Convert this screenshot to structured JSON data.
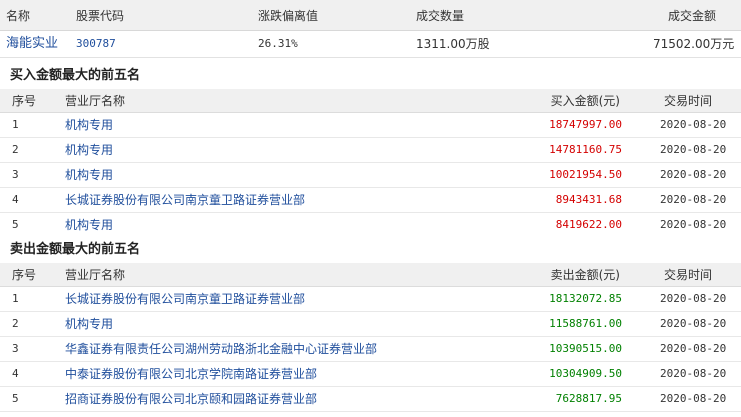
{
  "summary": {
    "headers": [
      "名称",
      "股票代码",
      "涨跌偏离值",
      "成交数量",
      "成交金额"
    ],
    "name": "海能实业",
    "code": "300787",
    "deviation": "26.31%",
    "volume": "1311.00万股",
    "amount": "71502.00万元"
  },
  "buy": {
    "title": "买入金额最大的前五名",
    "col_no": "序号",
    "col_dept": "营业厅名称",
    "col_amount": "买入金额(元)",
    "col_date": "交易时间",
    "rows": [
      {
        "no": "1",
        "dept": "机构专用",
        "amount": "18747997.00",
        "date": "2020-08-20"
      },
      {
        "no": "2",
        "dept": "机构专用",
        "amount": "14781160.75",
        "date": "2020-08-20"
      },
      {
        "no": "3",
        "dept": "机构专用",
        "amount": "10021954.50",
        "date": "2020-08-20"
      },
      {
        "no": "4",
        "dept": "长城证券股份有限公司南京童卫路证券营业部",
        "amount": "8943431.68",
        "date": "2020-08-20"
      },
      {
        "no": "5",
        "dept": "机构专用",
        "amount": "8419622.00",
        "date": "2020-08-20"
      }
    ]
  },
  "sell": {
    "title": "卖出金额最大的前五名",
    "col_no": "序号",
    "col_dept": "营业厅名称",
    "col_amount": "卖出金额(元)",
    "col_date": "交易时间",
    "rows": [
      {
        "no": "1",
        "dept": "长城证券股份有限公司南京童卫路证券营业部",
        "amount": "18132072.85",
        "date": "2020-08-20"
      },
      {
        "no": "2",
        "dept": "机构专用",
        "amount": "11588761.00",
        "date": "2020-08-20"
      },
      {
        "no": "3",
        "dept": "华鑫证券有限责任公司湖州劳动路浙北金融中心证券营业部",
        "amount": "10390515.00",
        "date": "2020-08-20"
      },
      {
        "no": "4",
        "dept": "中泰证券股份有限公司北京学院南路证券营业部",
        "amount": "10304909.50",
        "date": "2020-08-20"
      },
      {
        "no": "5",
        "dept": "招商证券股份有限公司北京颐和园路证券营业部",
        "amount": "7628817.95",
        "date": "2020-08-20"
      }
    ]
  },
  "colors": {
    "buy_amount": "#d40000",
    "sell_amount": "#008000",
    "link": "#1f4e9c",
    "header_bg": "#f0f0f0"
  }
}
